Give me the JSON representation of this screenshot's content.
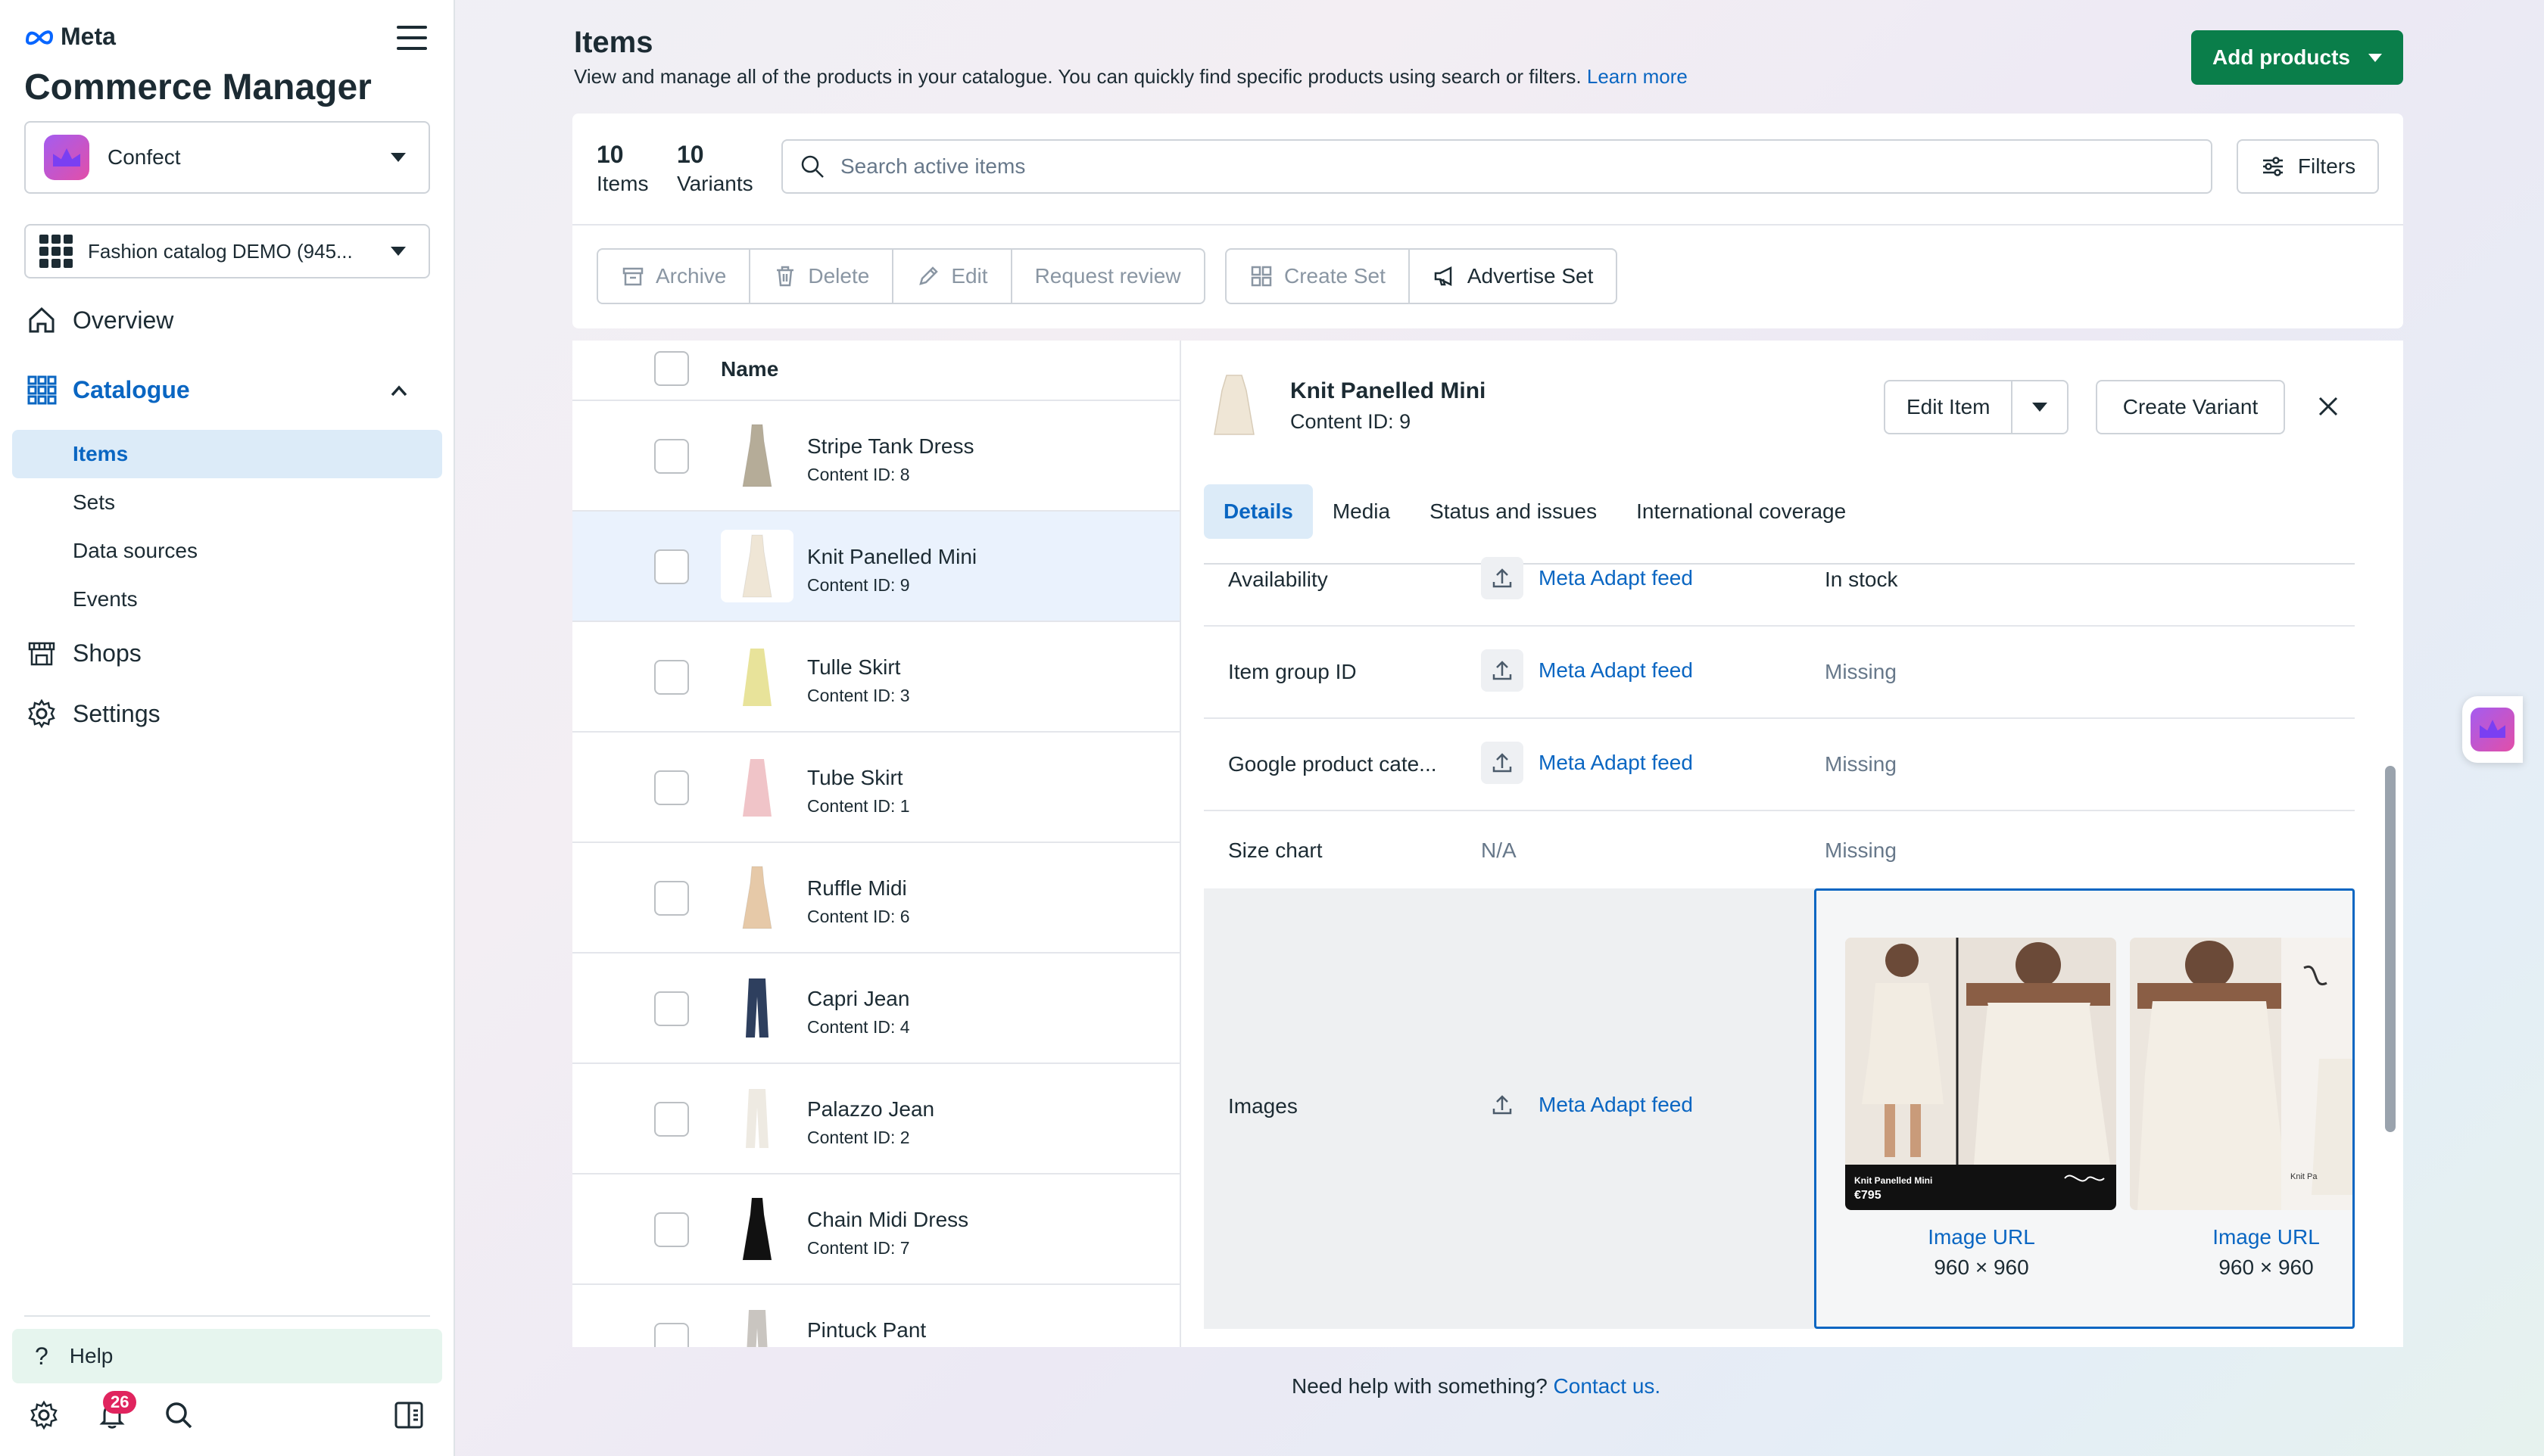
{
  "brand": {
    "logo_text": "Meta",
    "app_title": "Commerce Manager"
  },
  "sidebar": {
    "business": "Confect",
    "catalog": "Fashion catalog DEMO (945...",
    "nav": {
      "overview": "Overview",
      "catalogue": "Catalogue",
      "catalogue_sub": [
        "Items",
        "Sets",
        "Data sources",
        "Events"
      ],
      "shops": "Shops",
      "settings": "Settings"
    },
    "help": "Help",
    "notifications_count": "26"
  },
  "header": {
    "title": "Items",
    "description": "View and manage all of the products in your catalogue. You can quickly find specific products using search or filters.",
    "learn_more": "Learn more",
    "add_products": "Add products"
  },
  "toolbar": {
    "items_count": "10",
    "items_label": "Items",
    "variants_count": "10",
    "variants_label": "Variants",
    "search_placeholder": "Search active items",
    "filters": "Filters",
    "actions": [
      "Archive",
      "Delete",
      "Edit",
      "Request review"
    ],
    "set_actions": [
      "Create Set",
      "Advertise Set"
    ]
  },
  "table": {
    "header_name": "Name",
    "rows": [
      {
        "name": "Stripe Tank Dress",
        "id": "Content ID: 8",
        "color": "#b5ac98"
      },
      {
        "name": "Knit Panelled Mini",
        "id": "Content ID: 9",
        "color": "#efe6d6"
      },
      {
        "name": "Tulle Skirt",
        "id": "Content ID: 3",
        "color": "#e8e39a"
      },
      {
        "name": "Tube Skirt",
        "id": "Content ID: 1",
        "color": "#f0c4c8"
      },
      {
        "name": "Ruffle Midi",
        "id": "Content ID: 6",
        "color": "#e6c9a8"
      },
      {
        "name": "Capri Jean",
        "id": "Content ID: 4",
        "color": "#2e3f5e"
      },
      {
        "name": "Palazzo Jean",
        "id": "Content ID: 2",
        "color": "#eeeae2"
      },
      {
        "name": "Chain Midi Dress",
        "id": "Content ID: 7",
        "color": "#111111"
      },
      {
        "name": "Pintuck Pant",
        "id": "",
        "color": "#c9c5c0"
      }
    ]
  },
  "detail": {
    "title": "Knit Panelled Mini",
    "content_id": "Content ID: 9",
    "edit_item": "Edit Item",
    "create_variant": "Create Variant",
    "tabs": [
      "Details",
      "Media",
      "Status and issues",
      "International coverage"
    ],
    "fields": [
      {
        "label": "Availability",
        "source": "Meta Adapt feed",
        "value": "In stock"
      },
      {
        "label": "Item group ID",
        "source": "Meta Adapt feed",
        "value": "Missing"
      },
      {
        "label": "Google product cate...",
        "source": "Meta Adapt feed",
        "value": "Missing"
      },
      {
        "label": "Size chart",
        "source": "N/A",
        "value": "Missing"
      }
    ],
    "images": {
      "label": "Images",
      "source": "Meta Adapt feed",
      "cards": [
        {
          "link": "Image URL",
          "dims": "960 × 960",
          "overlay_name": "Knit Panelled Mini",
          "overlay_price": "€795"
        },
        {
          "link": "Image URL",
          "dims": "960 × 960"
        }
      ],
      "partial_caption": "Knit Pa"
    }
  },
  "footer": {
    "text": "Need help with something?",
    "link": "Contact us."
  }
}
